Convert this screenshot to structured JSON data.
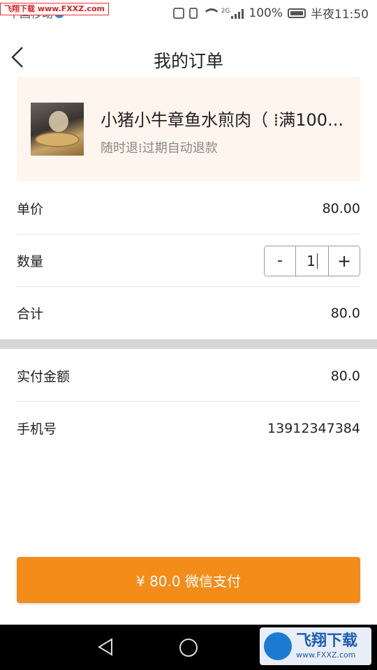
{
  "status_bar": {
    "watermark_text": "飞翔下载 www.FXXZ.com",
    "carrier": "中国移动",
    "network": "2G",
    "battery": "100%",
    "time": "半夜11:50"
  },
  "header": {
    "title": "我的订单"
  },
  "product": {
    "name": "小猪小牛章鱼水煎肉（ ⁞满100...",
    "tags": "随时退⁞过期自动退款"
  },
  "order": {
    "unit_price_label": "单价",
    "unit_price_value": "80.00",
    "quantity_label": "数量",
    "quantity_value": "1",
    "minus_label": "-",
    "plus_label": "+",
    "subtotal_label": "合计",
    "subtotal_value": "80.0"
  },
  "payment": {
    "actual_label": "实付金额",
    "actual_value": "80.0",
    "phone_label": "手机号",
    "phone_value": "13912347384"
  },
  "pay_button": {
    "label": "¥ 80.0 微信支付"
  },
  "watermark": {
    "brand": "飞翔下载",
    "url": "www.FXXZ.com"
  },
  "colors": {
    "accent": "#f48c1a",
    "card_bg": "#fdf5ee",
    "section_gap": "#d6d6d6"
  }
}
